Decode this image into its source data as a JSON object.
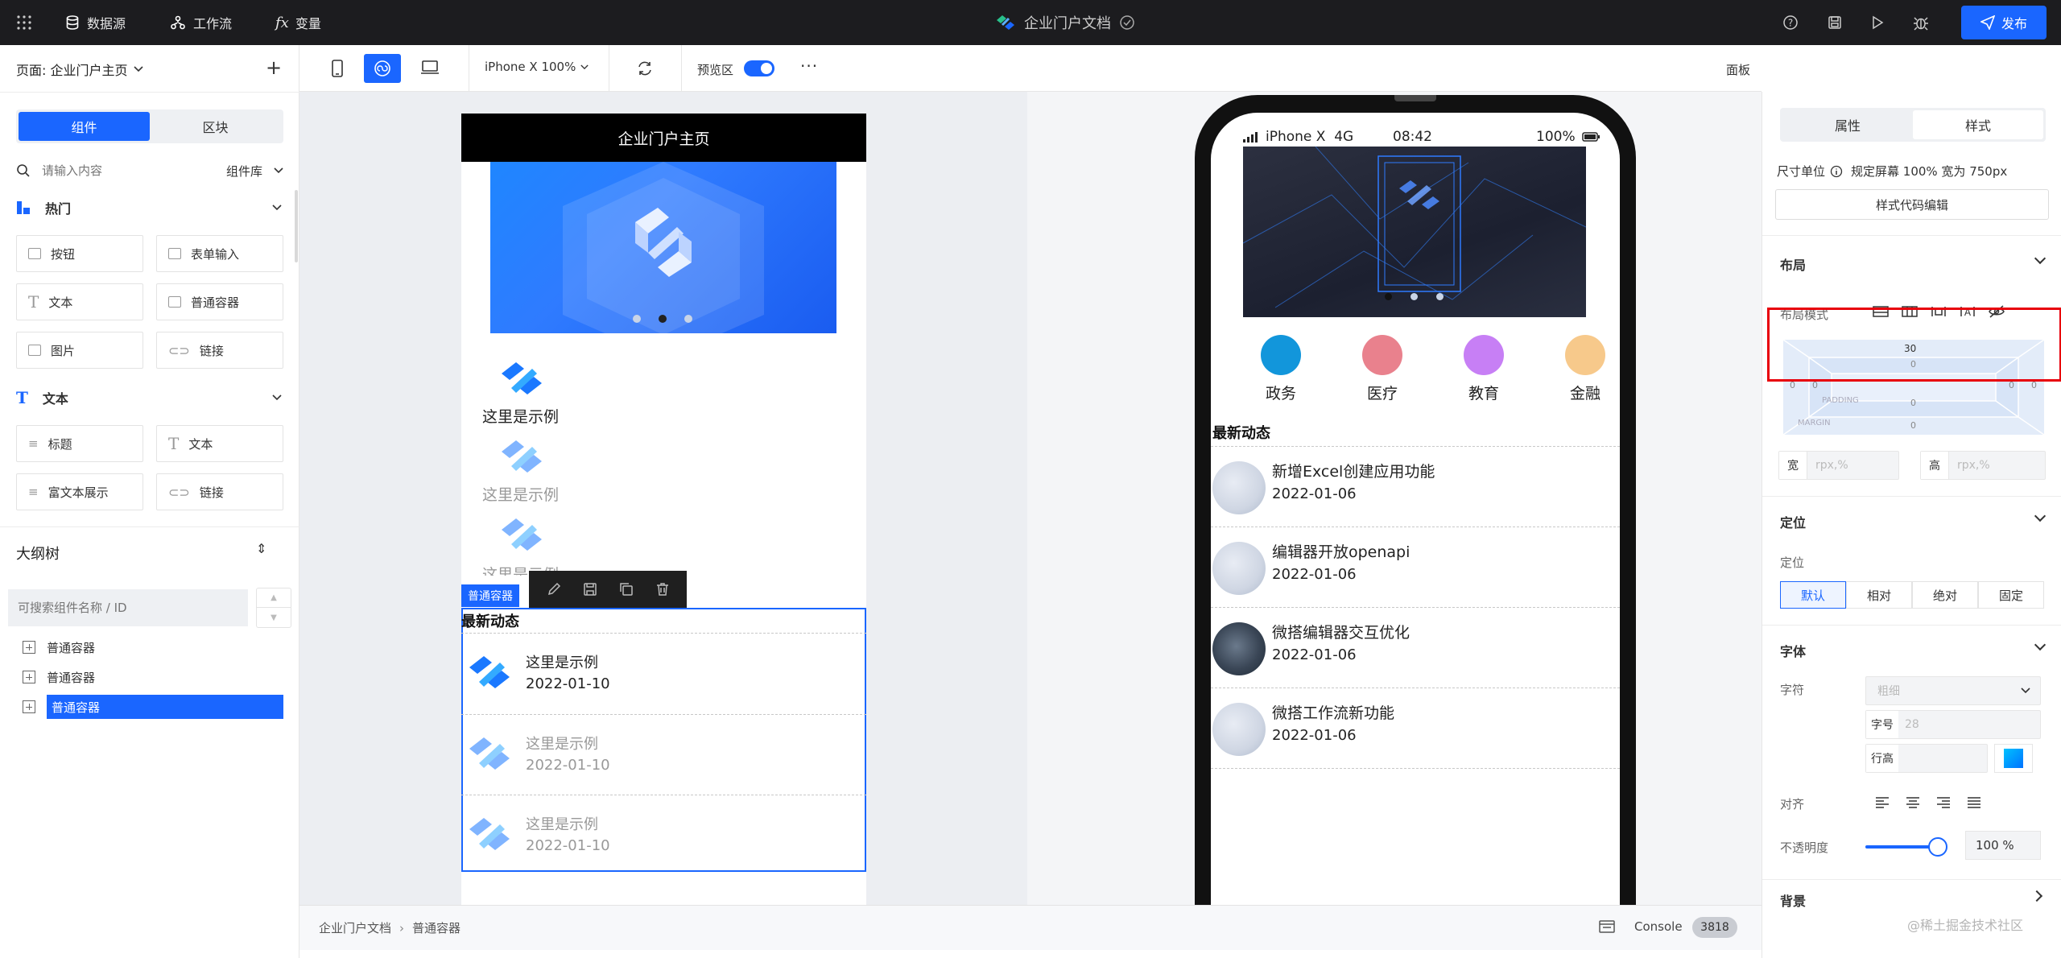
{
  "topbar": {
    "datasource": "数据源",
    "workflow": "工作流",
    "variables": "变量",
    "doc_title": "企业门户文档",
    "publish": "发布"
  },
  "left": {
    "page_label": "页面: 企业门户主页",
    "tab_components": "组件",
    "tab_blocks": "区块",
    "search_placeholder": "请输入内容",
    "library": "组件库",
    "hot_title": "热门",
    "hot_items": [
      "按钮",
      "表单输入",
      "文本",
      "普通容器",
      "图片",
      "链接"
    ],
    "text_title": "文本",
    "text_items": [
      "标题",
      "文本",
      "富文本展示",
      "链接"
    ],
    "outline_title": "大纲树",
    "outline_search_placeholder": "可搜索组件名称 / ID",
    "outline_items": [
      "普通容器",
      "普通容器",
      "普通容器"
    ]
  },
  "toolbar": {
    "device": "iPhone X 100%",
    "preview": "预览区",
    "panel": "面板"
  },
  "editor": {
    "header": "企业门户主页",
    "example_label": "这里是示例",
    "container_tag": "普通容器",
    "news_title": "最新动态",
    "rows": [
      {
        "title": "这里是示例",
        "date": "2022-01-10"
      },
      {
        "title": "这里是示例",
        "date": "2022-01-10"
      },
      {
        "title": "这里是示例",
        "date": "2022-01-10"
      }
    ]
  },
  "phone": {
    "carrier": "iPhone X  4G",
    "time": "08:42",
    "battery": "100%",
    "categories": [
      {
        "label": "政务",
        "color": "#1296db"
      },
      {
        "label": "医疗",
        "color": "#e9818d"
      },
      {
        "label": "教育",
        "color": "#c77ff5"
      },
      {
        "label": "金融",
        "color": "#f7c98b"
      }
    ],
    "news_title": "最新动态",
    "news": [
      {
        "title": "新增Excel创建应用功能",
        "date": "2022-01-06"
      },
      {
        "title": "编辑器开放openapi",
        "date": "2022-01-06"
      },
      {
        "title": "微搭编辑器交互优化",
        "date": "2022-01-06"
      },
      {
        "title": "微搭工作流新功能",
        "date": "2022-01-06"
      }
    ]
  },
  "bottombar": {
    "crumb_root": "企业门户文档",
    "crumb_leaf": "普通容器",
    "console": "Console",
    "console_count": "3818"
  },
  "right": {
    "tab_props": "属性",
    "tab_style": "样式",
    "unit_label": "尺寸单位",
    "unit_value": "规定屏幕 100% 宽为 750px",
    "code_edit": "样式代码编辑",
    "layout_title": "布局",
    "layout_mode": "布局模式",
    "margin_top": "30",
    "padding_top": "0",
    "padding_left": "0",
    "padding_right": "0",
    "padding_bottom": "0",
    "margin_left": "0",
    "margin_right": "0",
    "margin_bottom": "0",
    "padding_label": "PADDING",
    "margin_label": "MARGIN",
    "width_label": "宽",
    "height_label": "高",
    "size_placeholder": "rpx,%",
    "position_title": "定位",
    "position_label": "定位",
    "position_opts": [
      "默认",
      "相对",
      "绝对",
      "固定"
    ],
    "font_title": "字体",
    "font_label": "字符",
    "weight_placeholder": "粗细",
    "size_label": "字号",
    "size_value": "28",
    "lineheight_label": "行高",
    "align_label": "对齐",
    "opacity_label": "不透明度",
    "opacity_value": "100 %",
    "opacity_level": 1.0,
    "bg_title": "背景",
    "watermark": "@稀土掘金技术社区"
  },
  "colors": {
    "accent": "#1a66ff",
    "highlight": "#e8000b"
  }
}
